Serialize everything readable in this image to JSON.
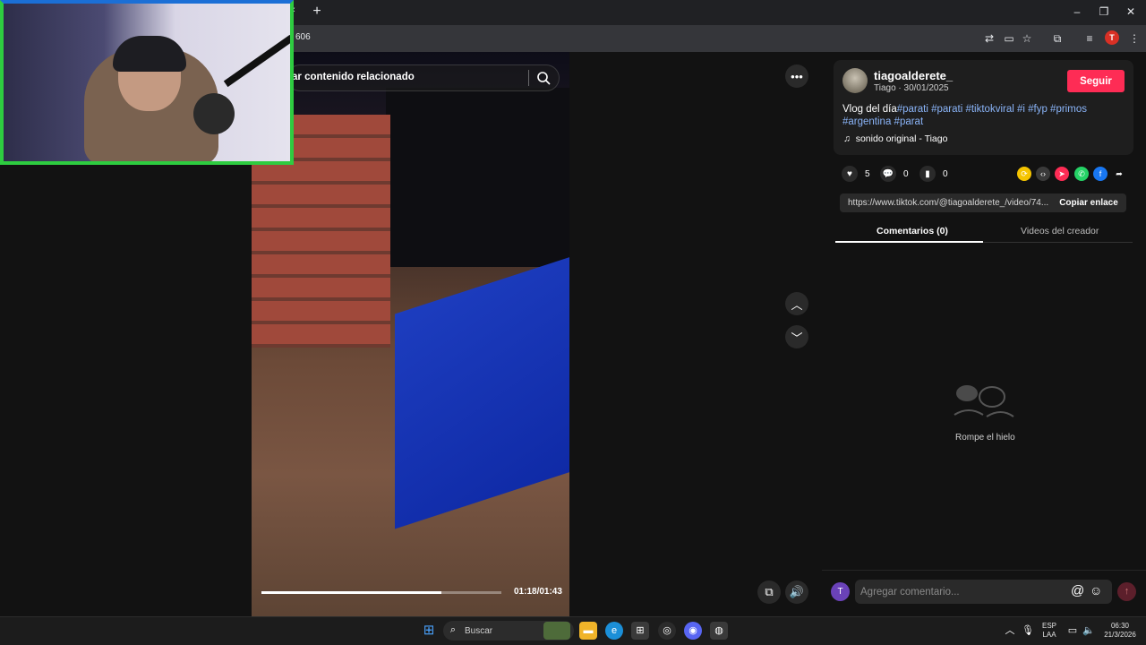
{
  "browser": {
    "new_tab": "+",
    "url": "606",
    "window_controls": {
      "minimize": "–",
      "maximize": "❐",
      "close": "✕"
    },
    "profile_initial": "T"
  },
  "video": {
    "search_placeholder": "ar contenido relacionado",
    "time": "01:18/01:43",
    "progress_fraction": 0.75
  },
  "post": {
    "username": "tiagoalderete_",
    "subtitle": "Tiago · 30/01/2025",
    "follow_label": "Seguir",
    "caption_prefix": "Vlog del día",
    "caption_tags_line1": "#parati #parati #tiktokviral #i #fyp #primos",
    "caption_tags_line2": "#argentina #parat",
    "sound": "sonido original - Tiago",
    "likes": "5",
    "comments": "0",
    "saves": "0",
    "link": "https://www.tiktok.com/@tiagoalderete_/video/74...",
    "copy_label": "Copiar enlace"
  },
  "tabs": {
    "comments": "Comentarios (0)",
    "creator_videos": "Videos del creador"
  },
  "empty_state": "Rompe el hielo",
  "comment_box": {
    "avatar_initial": "T",
    "placeholder": "Agregar comentario..."
  },
  "taskbar": {
    "search_label": "Buscar",
    "lang_line1": "ESP",
    "lang_line2": "LAA",
    "clock_time": "06:30",
    "clock_date": "21/3/2026"
  },
  "colors": {
    "follow": "#fe2c55",
    "hashtag": "#8ab4f8",
    "pool": "#1d3dbf"
  }
}
